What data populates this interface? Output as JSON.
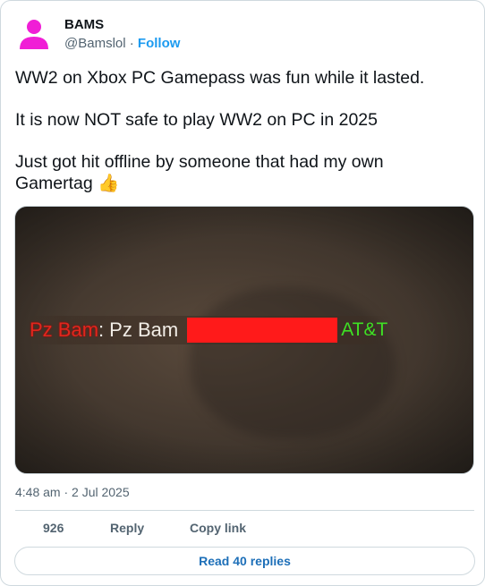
{
  "author": {
    "name": "BAMS",
    "handle": "@Bamslol",
    "separator": "·",
    "follow_label": "Follow",
    "avatar_color": "#f01ed6"
  },
  "tweet": {
    "paragraphs": [
      "WW2 on Xbox PC Gamepass was fun while it lasted.",
      "It is now NOT safe to play WW2 on PC in 2025",
      "Just got hit offline by someone that had my own Gamertag 👍"
    ],
    "timestamp": "4:48 am · 2 Jul 2025"
  },
  "media": {
    "killfeed_prefix": "Pz Bam",
    "killfeed_colon": ":",
    "killfeed_name": "Pz Bam",
    "killfeed_isp": "AT&T",
    "redaction_color": "#ff1a1a",
    "isp_color": "#3ee024",
    "prefix_color": "#e0261d"
  },
  "actions": {
    "likes": "926",
    "reply_label": "Reply",
    "copy_label": "Copy link"
  },
  "read_replies_label": "Read 40 replies",
  "colors": {
    "link": "#1d9bf0",
    "muted": "#536471",
    "border": "#cfd9de"
  }
}
